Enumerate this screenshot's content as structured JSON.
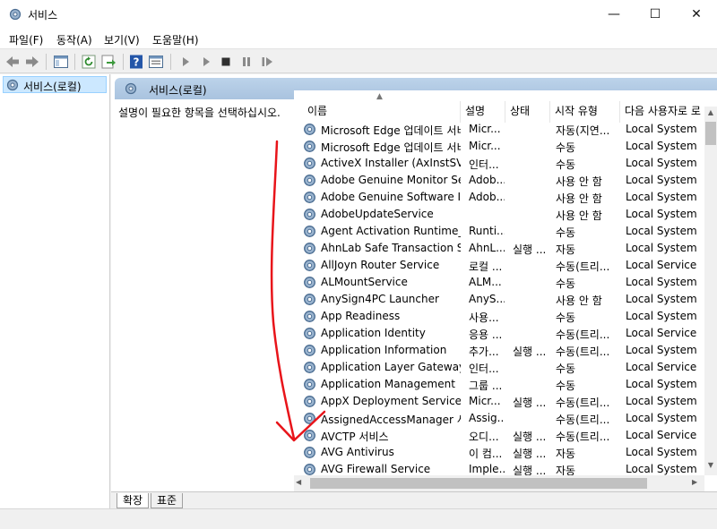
{
  "window": {
    "title": "서비스",
    "buttons": {
      "minimize": "—",
      "maximize": "☐",
      "close": "✕"
    }
  },
  "menu": [
    "파일(F)",
    "동작(A)",
    "보기(V)",
    "도움말(H)"
  ],
  "toolbar": {
    "icons": [
      "back-icon",
      "forward-icon",
      "show-console-tree-icon",
      "refresh-icon",
      "export-list-icon",
      "help-icon",
      "properties-icon",
      "start-service-icon",
      "start-service-alt-icon",
      "stop-service-icon",
      "pause-service-icon",
      "resume-service-icon"
    ]
  },
  "tree": {
    "root_label": "서비스(로컬)"
  },
  "pane": {
    "title": "서비스(로컬)",
    "description_hint": "설명이 필요한 항목을 선택하십시오."
  },
  "columns": [
    "이름",
    "설명",
    "상태",
    "시작 유형",
    "다음 사용자로 로"
  ],
  "services": [
    {
      "name": "Microsoft Edge 업데이트 서비스 (edgeupdate)",
      "desc": "Micr...",
      "status": "",
      "startup": "자동(지연...",
      "logon": "Local System"
    },
    {
      "name": "Microsoft Edge 업데이트 서비스 (edgeupdatem)",
      "desc": "Micr...",
      "status": "",
      "startup": "수동",
      "logon": "Local System"
    },
    {
      "name": "ActiveX Installer (AxInstSV)",
      "desc": "인터...",
      "status": "",
      "startup": "수동",
      "logon": "Local System"
    },
    {
      "name": "Adobe Genuine Monitor Se...",
      "desc": "Adob...",
      "status": "",
      "startup": "사용 안 함",
      "logon": "Local System"
    },
    {
      "name": "Adobe Genuine Software In...",
      "desc": "Adob...",
      "status": "",
      "startup": "사용 안 함",
      "logon": "Local System"
    },
    {
      "name": "AdobeUpdateService",
      "desc": "",
      "status": "",
      "startup": "사용 안 함",
      "logon": "Local System"
    },
    {
      "name": "Agent Activation Runtime_...",
      "desc": "Runti...",
      "status": "",
      "startup": "수동",
      "logon": "Local System"
    },
    {
      "name": "AhnLab Safe Transaction Se...",
      "desc": "AhnL...",
      "status": "실행 ...",
      "startup": "자동",
      "logon": "Local System"
    },
    {
      "name": "AllJoyn Router Service",
      "desc": "로컬 ...",
      "status": "",
      "startup": "수동(트리...",
      "logon": "Local Service"
    },
    {
      "name": "ALMountService",
      "desc": "ALM...",
      "status": "",
      "startup": "수동",
      "logon": "Local System"
    },
    {
      "name": "AnySign4PC Launcher",
      "desc": "AnyS...",
      "status": "",
      "startup": "사용 안 함",
      "logon": "Local System"
    },
    {
      "name": "App Readiness",
      "desc": "사용...",
      "status": "",
      "startup": "수동",
      "logon": "Local System"
    },
    {
      "name": "Application Identity",
      "desc": "응용 ...",
      "status": "",
      "startup": "수동(트리...",
      "logon": "Local Service"
    },
    {
      "name": "Application Information",
      "desc": "추가...",
      "status": "실행 ...",
      "startup": "수동(트리...",
      "logon": "Local System"
    },
    {
      "name": "Application Layer Gateway ...",
      "desc": "인터...",
      "status": "",
      "startup": "수동",
      "logon": "Local Service"
    },
    {
      "name": "Application Management",
      "desc": "그룹 ...",
      "status": "",
      "startup": "수동",
      "logon": "Local System"
    },
    {
      "name": "AppX Deployment Service (...",
      "desc": "Micr...",
      "status": "실행 ...",
      "startup": "수동(트리...",
      "logon": "Local System"
    },
    {
      "name": "AssignedAccessManager 서...",
      "desc": "Assig...",
      "status": "",
      "startup": "수동(트리...",
      "logon": "Local System"
    },
    {
      "name": "AVCTP 서비스",
      "desc": "오디...",
      "status": "실행 ...",
      "startup": "수동(트리...",
      "logon": "Local Service"
    },
    {
      "name": "AVG Antivirus",
      "desc": "이 컴...",
      "status": "실행 ...",
      "startup": "자동",
      "logon": "Local System"
    },
    {
      "name": "AVG Firewall Service",
      "desc": "Imple...",
      "status": "실행 ...",
      "startup": "자동",
      "logon": "Local System"
    }
  ],
  "tabs": [
    "확장",
    "표준"
  ],
  "colors": {
    "selection": "#cce8ff",
    "pane_header": "#b4cde6",
    "annotation": "#e8141a",
    "gear": "#5a7fa8"
  }
}
